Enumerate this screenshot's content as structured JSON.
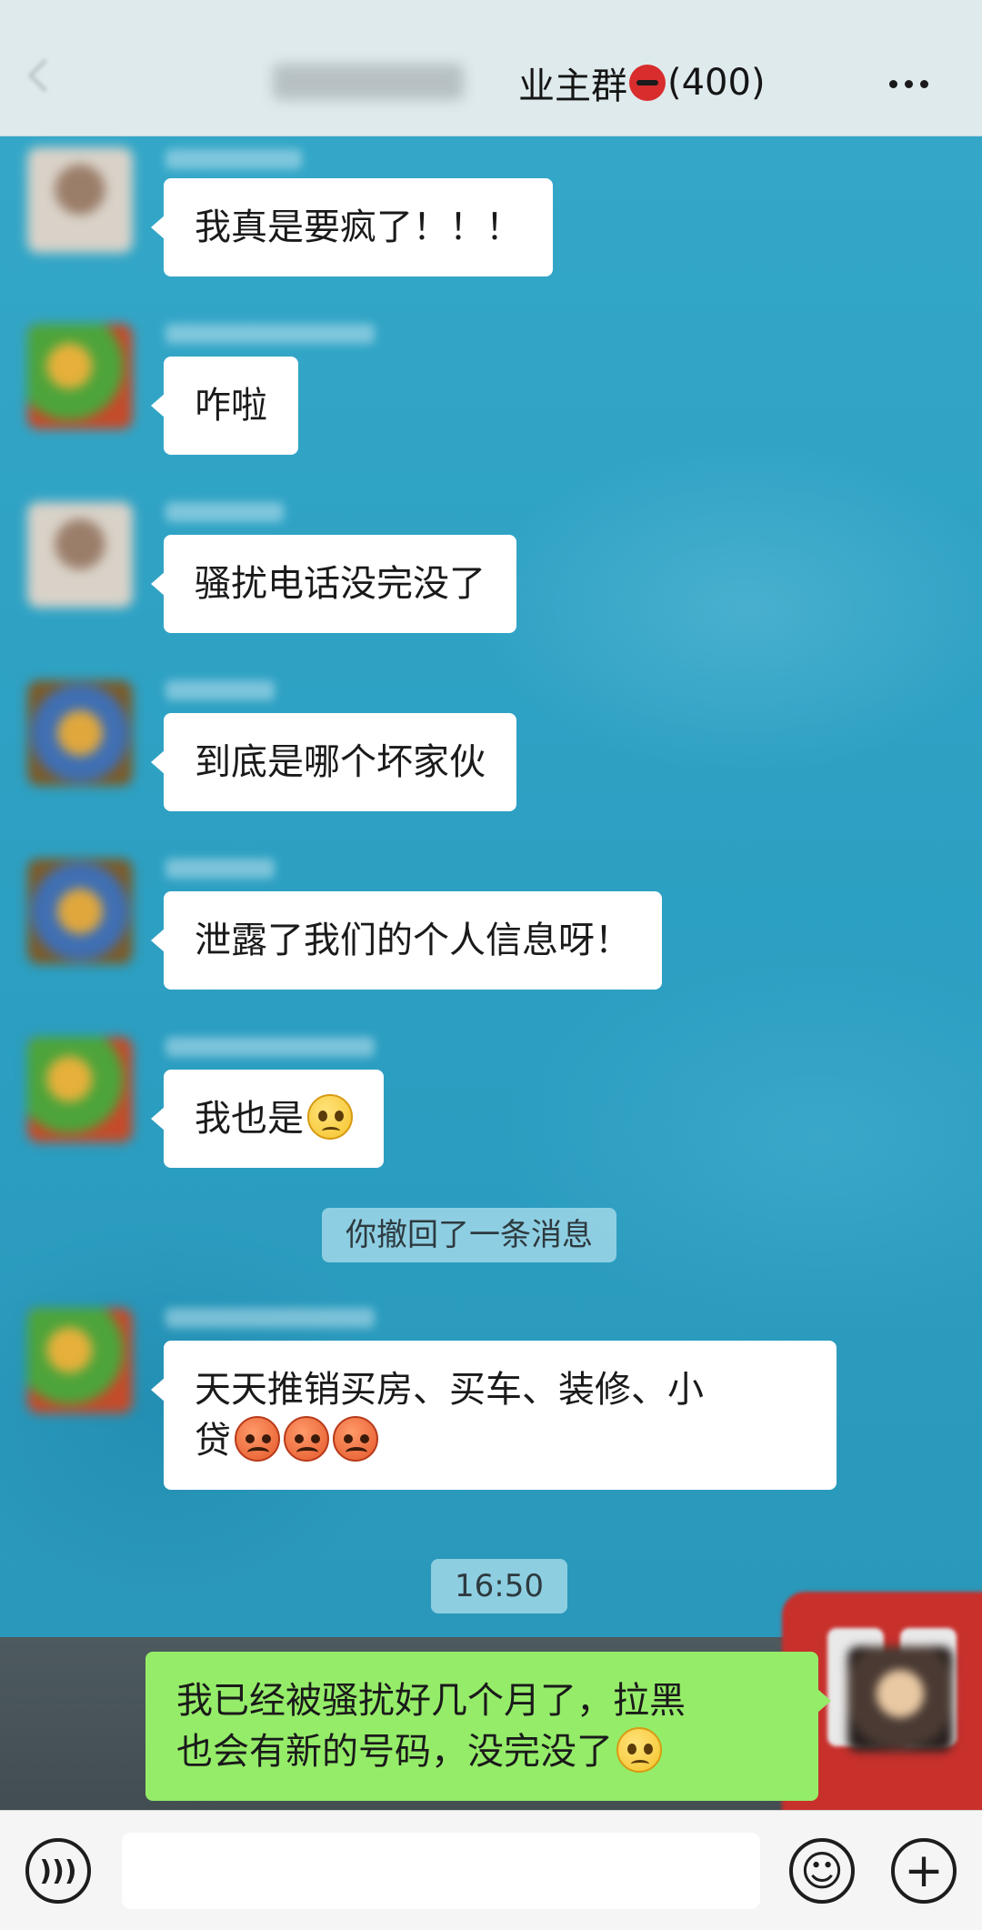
{
  "header": {
    "title_prefix": "业主群",
    "title_suffix": "(400)",
    "back_icon": "chevron-left-icon",
    "more_icon": "more-horizontal-icon"
  },
  "messages": [
    {
      "sender": "other",
      "text": "我真是要疯了！！！"
    },
    {
      "sender": "other",
      "text": "咋啦"
    },
    {
      "sender": "other",
      "text": "骚扰电话没完没了"
    },
    {
      "sender": "other",
      "text": "到底是哪个坏家伙"
    },
    {
      "sender": "other",
      "text": "泄露了我们的个人信息呀！"
    },
    {
      "sender": "other",
      "text": "我也是",
      "emoji": "worried-emoji"
    },
    {
      "sender": "system",
      "text": "你撤回了一条消息"
    },
    {
      "sender": "other",
      "text_line1": "天天推销买房、买车、装修、小",
      "text_line2": "贷",
      "emoji": "angry-emoji"
    },
    {
      "sender": "time",
      "text": "16:50"
    },
    {
      "sender": "me",
      "text_line1": "我已经被骚扰好几个月了，拉黑",
      "text_line2": "也会有新的号码，没完没了",
      "emoji": "worried-emoji"
    }
  ],
  "input_bar": {
    "voice_icon": "voice-icon",
    "emoji_icon": "emoji-icon",
    "plus_icon": "plus-icon",
    "input_value": ""
  },
  "colors": {
    "wallpaper": "#2fa2c3",
    "bubble_other": "#ffffff",
    "bubble_me": "#95ec69",
    "header_bg": "#dfeaed"
  }
}
